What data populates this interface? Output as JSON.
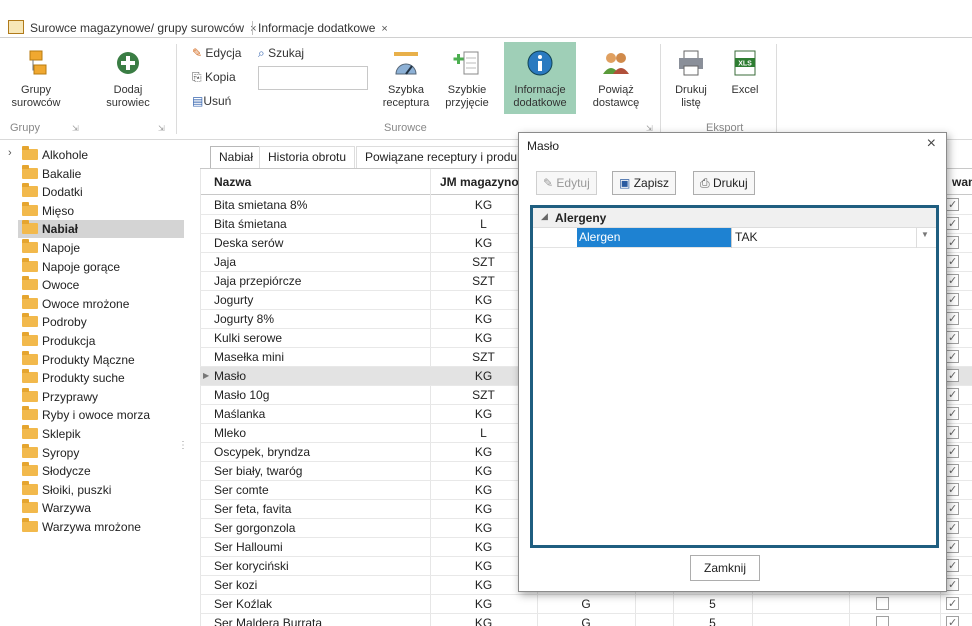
{
  "doc_tabs": [
    {
      "label": "Surowce magazynowe/ grupy surowców",
      "close": "×"
    },
    {
      "label": "Informacje dodatkowe",
      "close": "×"
    }
  ],
  "ribbon": {
    "grupy_surowcow": "Grupy\nsurowców",
    "dodaj_surowiec": "Dodaj\nsurowiec",
    "edycja": "Edycja",
    "kopia": "Kopia",
    "usun": "Usuń",
    "szukaj": "Szukaj",
    "szybka_receptura": "Szybka\nreceptura",
    "szybkie_przyjecie": "Szybkie\nprzyjęcie",
    "informacje_dodatkowe": "Informacje\ndodatkowe",
    "powiaz_dostawce": "Powiąż\ndostawcę",
    "drukuj_liste": "Drukuj\nlistę",
    "excel": "Excel",
    "group_grupy": "Grupy",
    "group_surowce": "Surowce",
    "group_eksport": "Eksport",
    "xls_badge": "XLS"
  },
  "tree": [
    "Alkohole",
    "Bakalie",
    "Dodatki",
    "Mięso",
    "Nabiał",
    "Napoje",
    "Napoje gorące",
    "Owoce",
    "Owoce mrożone",
    "Podroby",
    "Produkcja",
    "Produkty Mączne",
    "Produkty suche",
    "Przyprawy",
    "Ryby i owoce morza",
    "Sklepik",
    "Syropy",
    "Słodycze",
    "Słoiki, puszki",
    "Warzywa",
    "Warzywa mrożone"
  ],
  "grid_tabs": [
    "Nabiał",
    "Historia obrotu",
    "Powiązane receptury i produkty"
  ],
  "grid": {
    "col_nazwa": "Nazwa",
    "col_jm": "JM magazynow",
    "col_last": "wany",
    "rows": [
      {
        "nazwa": "Bita smietana 8%",
        "jm": "KG"
      },
      {
        "nazwa": "Bita śmietana",
        "jm": "L"
      },
      {
        "nazwa": "Deska serów",
        "jm": "KG"
      },
      {
        "nazwa": "Jaja",
        "jm": "SZT"
      },
      {
        "nazwa": "Jaja przepiórcze",
        "jm": "SZT"
      },
      {
        "nazwa": "Jogurty",
        "jm": "KG"
      },
      {
        "nazwa": "Jogurty 8%",
        "jm": "KG"
      },
      {
        "nazwa": "Kulki serowe",
        "jm": "KG"
      },
      {
        "nazwa": "Masełka mini",
        "jm": "SZT"
      },
      {
        "nazwa": "Masło",
        "jm": "KG"
      },
      {
        "nazwa": "Masło 10g",
        "jm": "SZT"
      },
      {
        "nazwa": "Maślanka",
        "jm": "KG"
      },
      {
        "nazwa": "Mleko",
        "jm": "L"
      },
      {
        "nazwa": "Oscypek, bryndza",
        "jm": "KG"
      },
      {
        "nazwa": "Ser biały, twaróg",
        "jm": "KG"
      },
      {
        "nazwa": "Ser comte",
        "jm": "KG"
      },
      {
        "nazwa": "Ser feta, favita",
        "jm": "KG"
      },
      {
        "nazwa": "Ser gorgonzola",
        "jm": "KG"
      },
      {
        "nazwa": "Ser Halloumi",
        "jm": "KG"
      },
      {
        "nazwa": "Ser koryciński",
        "jm": "KG"
      },
      {
        "nazwa": "Ser kozi",
        "jm": "KG"
      },
      {
        "nazwa": "Ser Koźlak",
        "jm": "KG",
        "c3": "G",
        "c5": "5"
      },
      {
        "nazwa": "Ser Maldera Burrata",
        "jm": "KG",
        "c3": "G",
        "c5": "5"
      }
    ]
  },
  "dialog": {
    "title": "Masło",
    "close": "×",
    "edytuj": "Edytuj",
    "zapisz": "Zapisz",
    "drukuj": "Drukuj",
    "category": "Alergeny",
    "prop_name": "Alergen",
    "prop_value": "TAK",
    "zamknij": "Zamknij"
  },
  "colors": {
    "selected_ribbon": "#9fcfb7",
    "dialog_border": "#1f5e80",
    "prop_select": "#1e82d2"
  }
}
